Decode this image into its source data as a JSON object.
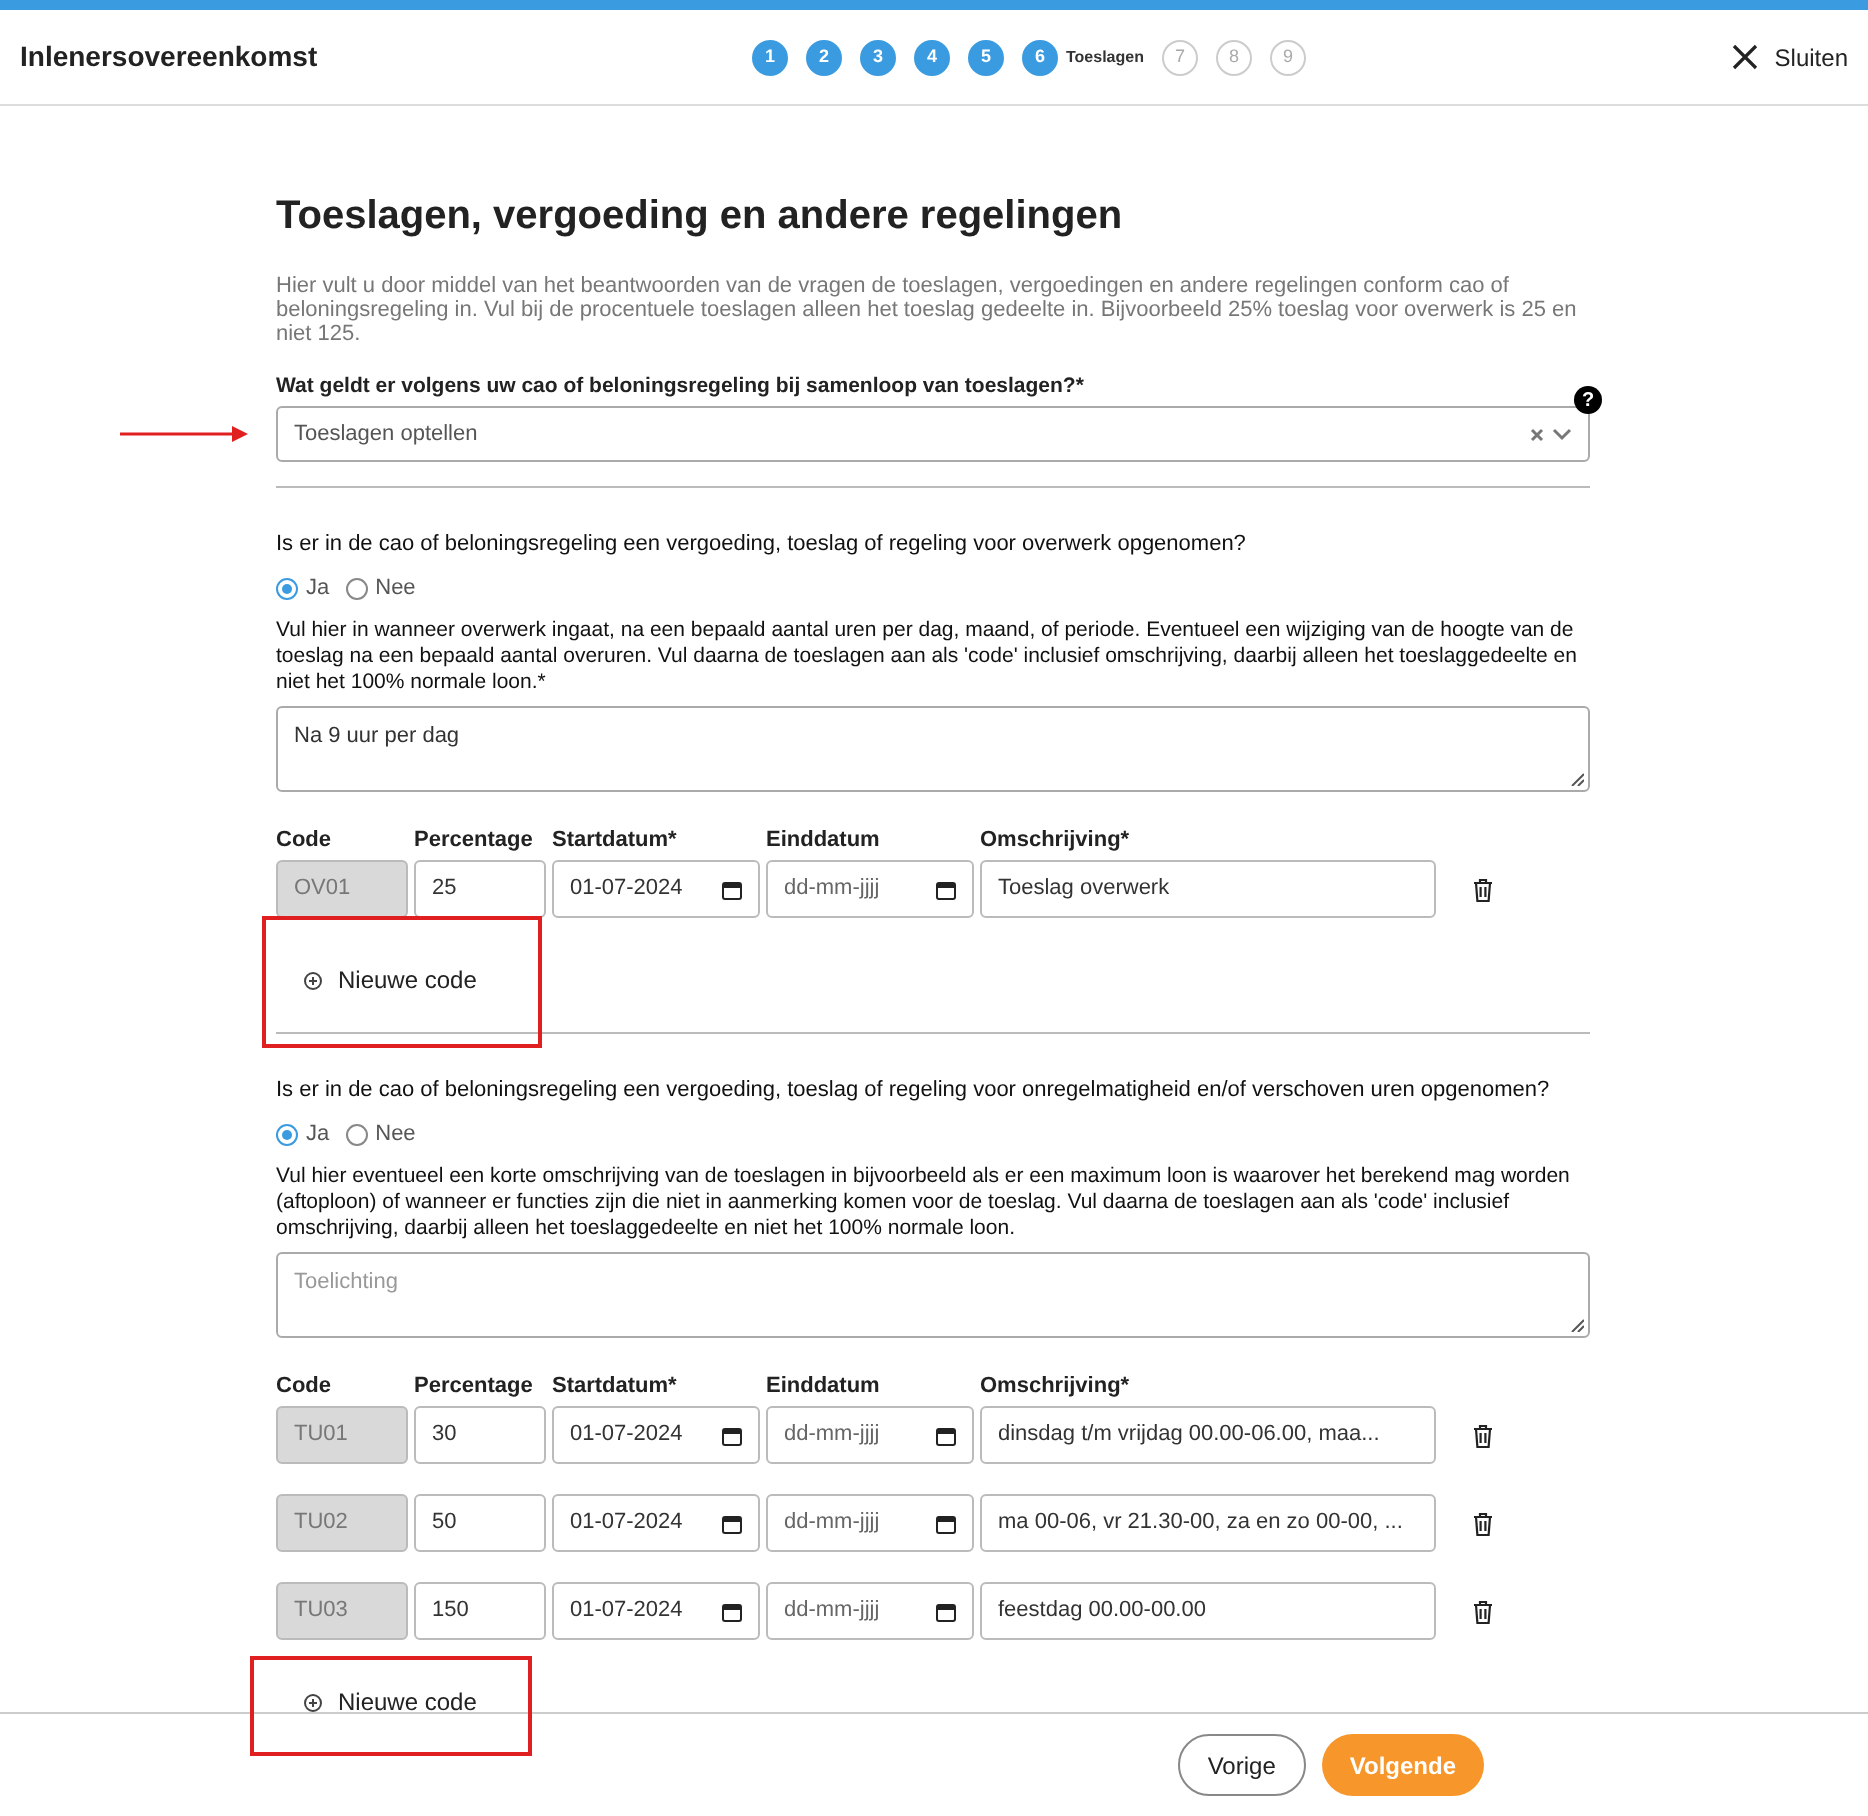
{
  "window": {
    "title": "Inlenersovereenkomst"
  },
  "steps": [
    {
      "number": "1",
      "kind": "done"
    },
    {
      "number": "2",
      "kind": "done"
    },
    {
      "number": "3",
      "kind": "done"
    },
    {
      "number": "4",
      "kind": "done"
    },
    {
      "number": "5",
      "kind": "done"
    },
    {
      "number": "6",
      "kind": "current",
      "label": "Toeslagen"
    },
    {
      "number": "7",
      "kind": "todo"
    },
    {
      "number": "8",
      "kind": "todo"
    },
    {
      "number": "9",
      "kind": "todo"
    }
  ],
  "close": "Sluiten",
  "page": {
    "title": "Toeslagen, vergoeding en andere regelingen",
    "intro": "Hier vult u door middel van het beantwoorden van de vragen de toeslagen, vergoedingen en andere regelingen conform cao of beloningsregeling in. Vul bij de procentuele toeslagen alleen het toeslag gedeelte in. Bijvoorbeeld 25% toeslag voor overwerk is 25 en niet 125."
  },
  "combine": {
    "label": "Wat geldt er volgens uw cao of beloningsregeling bij samenloop van toeslagen?*",
    "value": "Toeslagen optellen",
    "help": "?",
    "arrow": true
  },
  "sections": [
    {
      "question": "Is er in de cao of beloningsregeling een vergoeding, toeslag of regeling voor overwerk opgenomen?",
      "options": [
        {
          "label": "Ja",
          "selected": true
        },
        {
          "label": "Nee",
          "selected": false
        }
      ],
      "explanation": "Vul hier in wanneer overwerk ingaat, na een bepaald aantal uren per dag, maand, of periode. Eventueel een wijziging van de hoogte van de toeslag na een bepaald aantal overuren. Vul daarna de toeslagen aan als 'code' inclusief omschrijving, daarbij alleen het toeslaggedeelte en niet het 100% normale loon.*",
      "textarea": {
        "value": "Na 9 uur per dag"
      },
      "columns": [
        "Code",
        "Percentage",
        "Startdatum*",
        "Einddatum",
        "Omschrijving*"
      ],
      "rows": [
        {
          "code": "OV01",
          "percentage": "25",
          "start": "01-07-2024",
          "end": "dd-mm-jjjj",
          "description": "Toeslag overwerk"
        }
      ],
      "add": "Nieuwe code",
      "highlighted": true
    },
    {
      "question": "Is er in de cao of beloningsregeling een vergoeding, toeslag of regeling voor onregelmatigheid en/of verschoven uren opgenomen?",
      "options": [
        {
          "label": "Ja",
          "selected": true
        },
        {
          "label": "Nee",
          "selected": false
        }
      ],
      "explanation": "Vul hier eventueel een korte omschrijving van de toeslagen in bijvoorbeeld als er een maximum loon is waarover het berekend mag worden (aftoploon) of wanneer er functies zijn die niet in aanmerking komen voor de toeslag. Vul daarna de toeslagen aan als 'code' inclusief omschrijving, daarbij alleen het toeslaggedeelte en niet het 100% normale loon.",
      "textarea": {
        "placeholder": "Toelichting"
      },
      "columns": [
        "Code",
        "Percentage",
        "Startdatum*",
        "Einddatum",
        "Omschrijving*"
      ],
      "rows": [
        {
          "code": "TU01",
          "percentage": "30",
          "start": "01-07-2024",
          "end": "dd-mm-jjjj",
          "description": "dinsdag t/m vrijdag 00.00-06.00, maa..."
        },
        {
          "code": "TU02",
          "percentage": "50",
          "start": "01-07-2024",
          "end": "dd-mm-jjjj",
          "description": "ma 00-06, vr 21.30-00, za en zo 00-00, ..."
        },
        {
          "code": "TU03",
          "percentage": "150",
          "start": "01-07-2024",
          "end": "dd-mm-jjjj",
          "description": "feestdag 00.00-00.00"
        }
      ],
      "add": "Nieuwe code",
      "highlighted": true
    }
  ],
  "footer": {
    "back": "Vorige",
    "next": "Volgende"
  }
}
